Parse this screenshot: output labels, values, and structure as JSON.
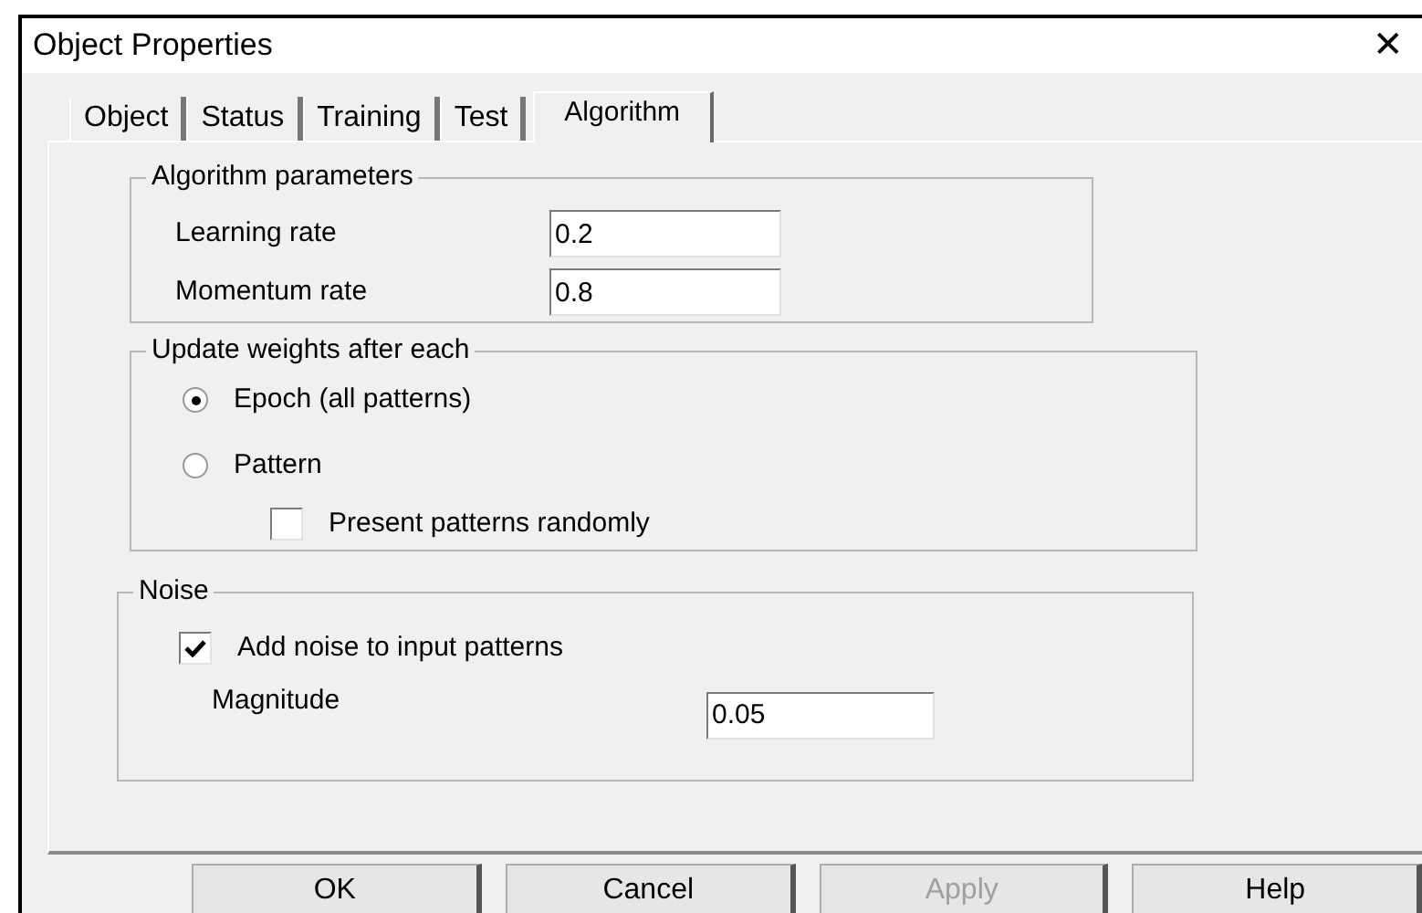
{
  "window": {
    "title": "Object Properties",
    "close": "✕"
  },
  "tabs": [
    {
      "label": "Object",
      "selected": false
    },
    {
      "label": "Status",
      "selected": false
    },
    {
      "label": "Training",
      "selected": false
    },
    {
      "label": "Test",
      "selected": false
    },
    {
      "label": "Algorithm",
      "selected": true
    }
  ],
  "algorithm_parameters": {
    "title": "Algorithm parameters",
    "fields": [
      {
        "label": "Learning rate",
        "value": "0.2"
      },
      {
        "label": "Momentum rate",
        "value": "0.8"
      }
    ]
  },
  "update_weights": {
    "title": "Update weights after each",
    "options": [
      {
        "label": "Epoch (all patterns)",
        "selected": true
      },
      {
        "label": "Pattern",
        "selected": false
      }
    ],
    "randomly": {
      "label": "Present patterns randomly",
      "checked": false
    }
  },
  "noise": {
    "title": "Noise",
    "add_noise": {
      "label": "Add noise to input patterns",
      "checked": true
    },
    "magnitude": {
      "label": "Magnitude",
      "value": "0.05"
    }
  },
  "buttons": [
    {
      "label": "OK",
      "disabled": false
    },
    {
      "label": "Cancel",
      "disabled": false
    },
    {
      "label": "Apply",
      "disabled": true
    },
    {
      "label": "Help",
      "disabled": false
    }
  ]
}
